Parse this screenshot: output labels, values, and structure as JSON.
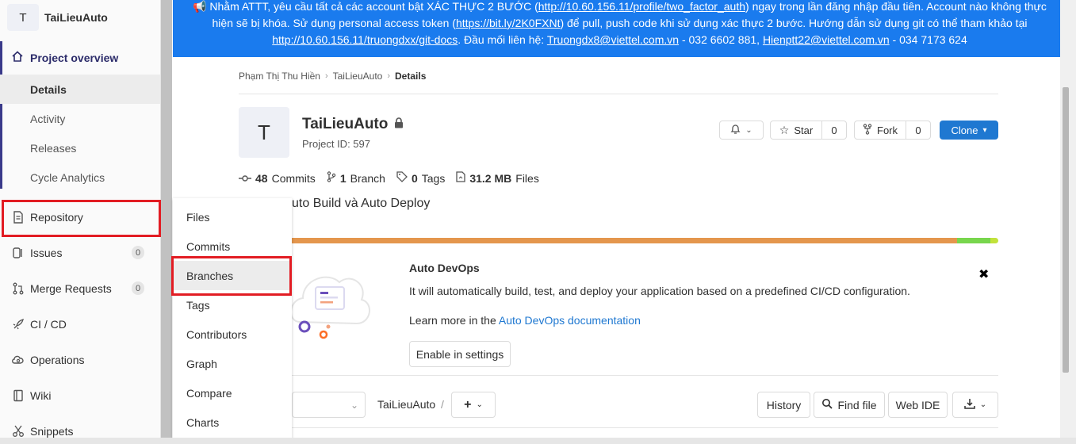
{
  "sidebar": {
    "project_initial": "T",
    "project_name": "TaiLieuAuto",
    "overview_label": "Project overview",
    "overview_sub": [
      "Details",
      "Activity",
      "Releases",
      "Cycle Analytics"
    ],
    "repository_label": "Repository",
    "issues_label": "Issues",
    "issues_count": "0",
    "mr_label": "Merge Requests",
    "mr_count": "0",
    "cicd_label": "CI / CD",
    "operations_label": "Operations",
    "wiki_label": "Wiki",
    "snippets_label": "Snippets"
  },
  "flyout": {
    "items": [
      "Files",
      "Commits",
      "Branches",
      "Tags",
      "Contributors",
      "Graph",
      "Compare",
      "Charts"
    ]
  },
  "banner": {
    "t1": "📢 Nhằm ATTT, yêu cầu tất cả các account bật XÁC THỰC 2 BƯỚC (",
    "l1": "http://10.60.156.11/profile/two_factor_auth",
    "t2": ") ngay trong lần đăng nhập đầu tiên. Account nào không thực hiện sẽ bị khóa. Sử dụng personal access token (",
    "l2": "https://bit.ly/2K0FXNt",
    "t3": ") để pull, push code khi sử dụng xác thực 2 bước. Hướng dẫn sử dụng git có thể tham khảo tại ",
    "l3": "http://10.60.156.11/truongdxx/git-docs",
    "t4": ". Đầu mối liên hệ: ",
    "l4": "Truongdx8@viettel.com.vn",
    "t5": " - 032 6602 881, ",
    "l5": "Hienptt22@viettel.com.vn",
    "t6": " - 034 7173 624"
  },
  "breadcrumb": {
    "items": [
      "Phạm Thị Thu Hiền",
      "TaiLieuAuto"
    ],
    "current": "Details"
  },
  "project": {
    "initial": "T",
    "name": "TaiLieuAuto",
    "id_text": "Project ID: 597",
    "star_label": "Star",
    "star_count": "0",
    "fork_label": "Fork",
    "fork_count": "0",
    "clone_label": "Clone",
    "commits_num": "48",
    "commits_label": "Commits",
    "branch_num": "1",
    "branch_label": "Branch",
    "tags_num": "0",
    "tags_label": "Tags",
    "files_num": "31.2 MB",
    "files_label": "Files",
    "description": "uto Build và Auto Deploy"
  },
  "lang_bar": {
    "colors": [
      "#e4964d",
      "#78d64d",
      "#c2e23b"
    ]
  },
  "devops": {
    "title": "Auto DevOps",
    "text": "It will automatically build, test, and deploy your application based on a predefined CI/CD configuration.",
    "learn_prefix": "Learn more in the ",
    "learn_link": "Auto DevOps documentation",
    "enable_label": "Enable in settings"
  },
  "repo_toolbar": {
    "path": "TaiLieuAuto",
    "sep": "/",
    "history": "History",
    "find_file": "Find file",
    "web_ide": "Web IDE"
  }
}
